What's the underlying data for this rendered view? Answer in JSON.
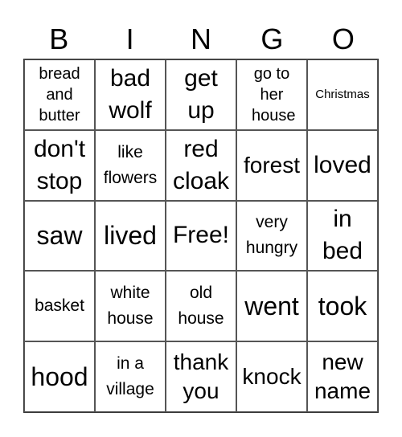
{
  "header": [
    "B",
    "I",
    "N",
    "G",
    "O"
  ],
  "cells": [
    [
      "bread and butter",
      "bad wolf",
      "get up",
      "go to her house",
      "Christmas"
    ],
    [
      "don't stop",
      "like flowers",
      "red cloak",
      "forest",
      "loved"
    ],
    [
      "saw",
      "lived",
      "Free!",
      "very hungry",
      "in bed"
    ],
    [
      "basket",
      "white house",
      "old house",
      "went",
      "took"
    ],
    [
      "hood",
      "in a village",
      "thank you",
      "knock",
      "new name"
    ]
  ]
}
